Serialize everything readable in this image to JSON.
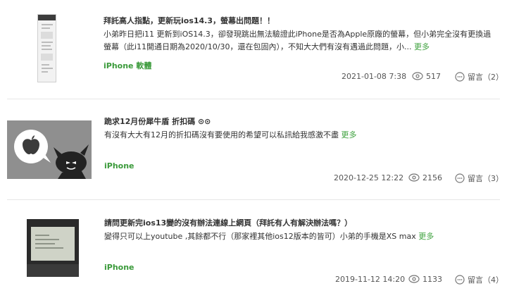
{
  "posts": [
    {
      "title": "拜託高人指點，更新玩ios14.3，螢幕出問題！！",
      "excerpt": "小弟昨日把i11 更新到iOS14.3，卻發現跳出無法驗證此iPhone是否為Apple原廠的螢幕，但小弟完全沒有更換過螢幕（此i11開通日期為2020/10/30，還在包固內），不知大大們有沒有遇過此問題，小...",
      "more": "更多",
      "tag": "iPhone 軟體",
      "date": "2021-01-08 7:38",
      "views": "517",
      "comments": "留言（2）"
    },
    {
      "title": "跪求12月份犀牛盾 折扣碼 ⊙⊙",
      "excerpt": "有沒有大大有12月的折扣碼沒有要使用的希望可以私訊給我感激不盡",
      "more": "更多",
      "tag": "iPhone",
      "date": "2020-12-25 12:22",
      "views": "2156",
      "comments": "留言（3）"
    },
    {
      "title": "請問更新完ios13變的沒有辦法連線上網頁（拜託有人有解決辦法嗎？）",
      "excerpt": "變得只可以上youtube ,其餘都不行（那家裡其他ios12版本的皆可）小弟的手機是XS max",
      "more": "更多",
      "tag": "iPhone",
      "date": "2019-11-12 14:20",
      "views": "1133",
      "comments": "留言（4）"
    }
  ],
  "icons": {
    "views": "eye-icon",
    "comments": "comment-bubble-icon"
  },
  "colors": {
    "link_green": "#3fa23f",
    "tag_green": "#3a9a3a",
    "divider": "#e6e6e6",
    "thumb_grey": "#8f8f8f"
  }
}
